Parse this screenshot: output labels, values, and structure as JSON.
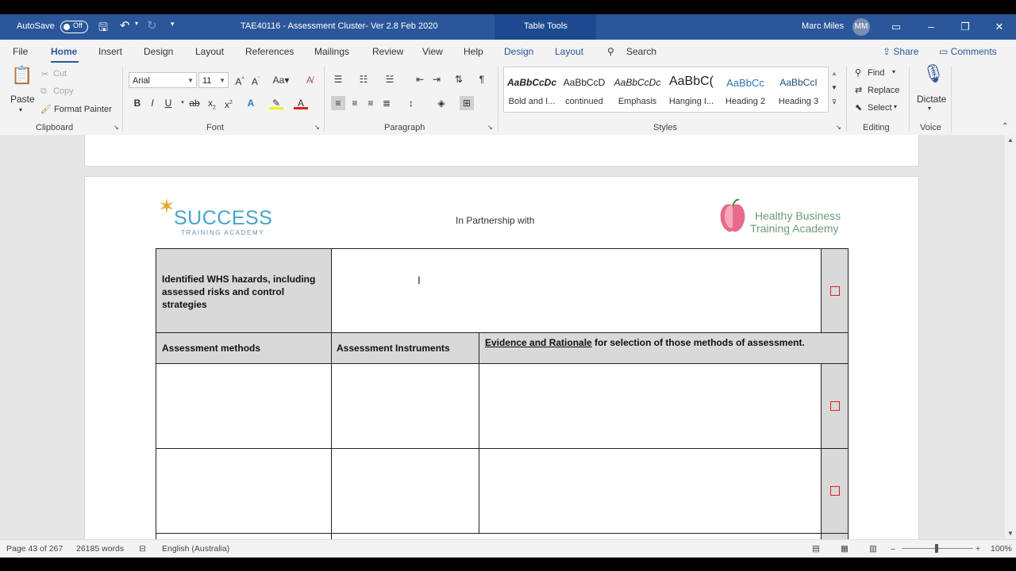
{
  "titlebar": {
    "autosave_label": "AutoSave",
    "autosave_state": "Off",
    "document_title": "TAE40116 - Assessment Cluster- Ver 2.8 Feb 2020",
    "context_tab": "Table Tools",
    "user_name": "Marc Miles",
    "user_initials": "MM"
  },
  "tabs": [
    "File",
    "Home",
    "Insert",
    "Design",
    "Layout",
    "References",
    "Mailings",
    "Review",
    "View",
    "Help",
    "Design",
    "Layout"
  ],
  "search_placeholder": "Search",
  "share_label": "Share",
  "comments_label": "Comments",
  "ribbon": {
    "clipboard": {
      "label": "Clipboard",
      "paste": "Paste",
      "cut": "Cut",
      "copy": "Copy",
      "format_painter": "Format Painter"
    },
    "font": {
      "label": "Font",
      "font_name": "Arial",
      "font_size": "11"
    },
    "paragraph": {
      "label": "Paragraph"
    },
    "styles": {
      "label": "Styles",
      "items": [
        {
          "preview": "AaBbCcDc",
          "name": "Bold and I..."
        },
        {
          "preview": "AaBbCcD",
          "name": "continued"
        },
        {
          "preview": "AaBbCcDc",
          "name": "Emphasis"
        },
        {
          "preview": "AaBbC(",
          "name": "Hanging I..."
        },
        {
          "preview": "AaBbCc",
          "name": "Heading 2"
        },
        {
          "preview": "AaBbCcI",
          "name": "Heading 3"
        }
      ]
    },
    "editing": {
      "label": "Editing",
      "find": "Find",
      "replace": "Replace",
      "select": "Select"
    },
    "voice": {
      "label": "Voice",
      "dictate": "Dictate"
    }
  },
  "document": {
    "logo_left_main": "SUCCESS",
    "logo_left_sub": "TRAINING ACADEMY",
    "partnership_text": "In Partnership with",
    "logo_right_line1": "Healthy Business",
    "logo_right_line2": "Training Academy",
    "table": {
      "row1_label": "Identified WHS hazards, including assessed risks and control strategies",
      "col_methods": "Assessment methods",
      "col_instruments": "Assessment Instruments",
      "col_evidence_underlined": "Evidence and Rationale",
      "col_evidence_rest": " for selection of those methods of assessment."
    }
  },
  "statusbar": {
    "page": "Page 43 of 267",
    "words": "26185 words",
    "language": "English (Australia)",
    "zoom": "100%"
  },
  "colors": {
    "title_bar": "#2b579a",
    "checkbox": "#e02020",
    "header_fill": "#d9d9d9"
  }
}
